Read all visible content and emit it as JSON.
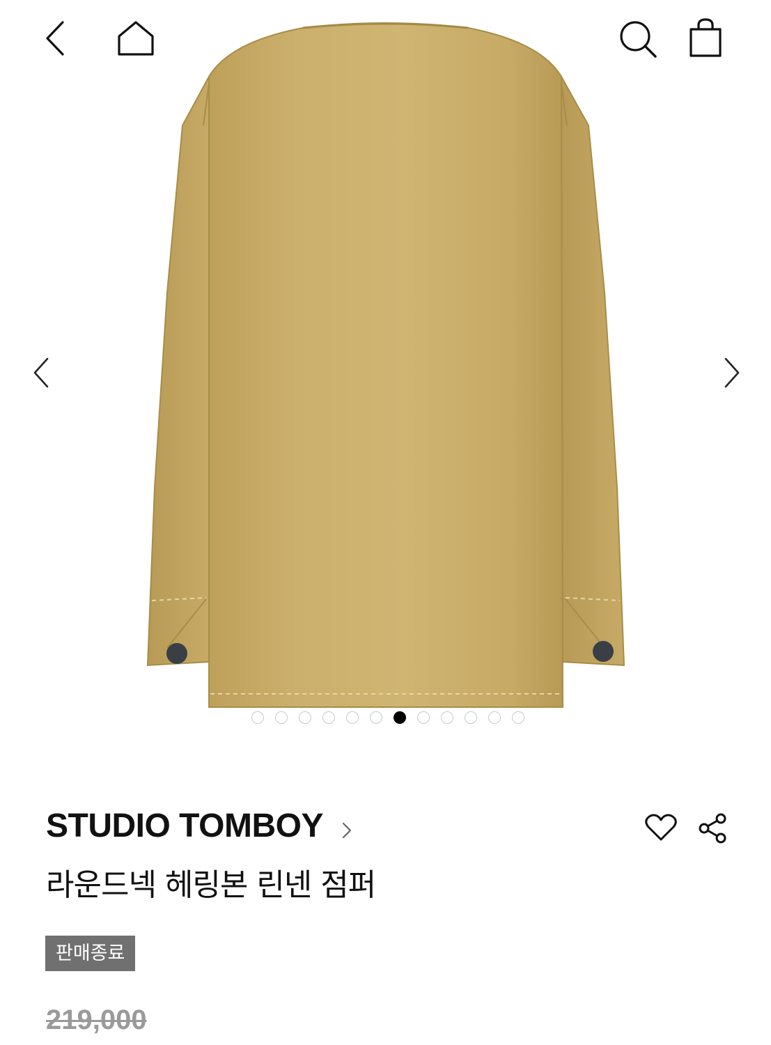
{
  "header": {
    "back_icon": "chevron-left-icon",
    "home_icon": "home-icon",
    "search_icon": "search-icon",
    "cart_icon": "shopping-bag-icon"
  },
  "gallery": {
    "prev_icon": "chevron-left-icon",
    "next_icon": "chevron-right-icon",
    "image_alt": "라운드넥 헤링본 린넨 점퍼",
    "garment_color": "#c9ad68",
    "dot_count": 12,
    "active_index": 6
  },
  "product": {
    "brand": "STUDIO TOMBOY",
    "name": "라운드넥 헤링본 린넨 점퍼",
    "status": "판매종료",
    "original_price": "219,000",
    "like_icon": "heart-icon",
    "share_icon": "share-icon"
  },
  "colors": {
    "badge_bg": "#707070",
    "price_strike": "#9a9a9a",
    "dot_active": "#000000"
  }
}
